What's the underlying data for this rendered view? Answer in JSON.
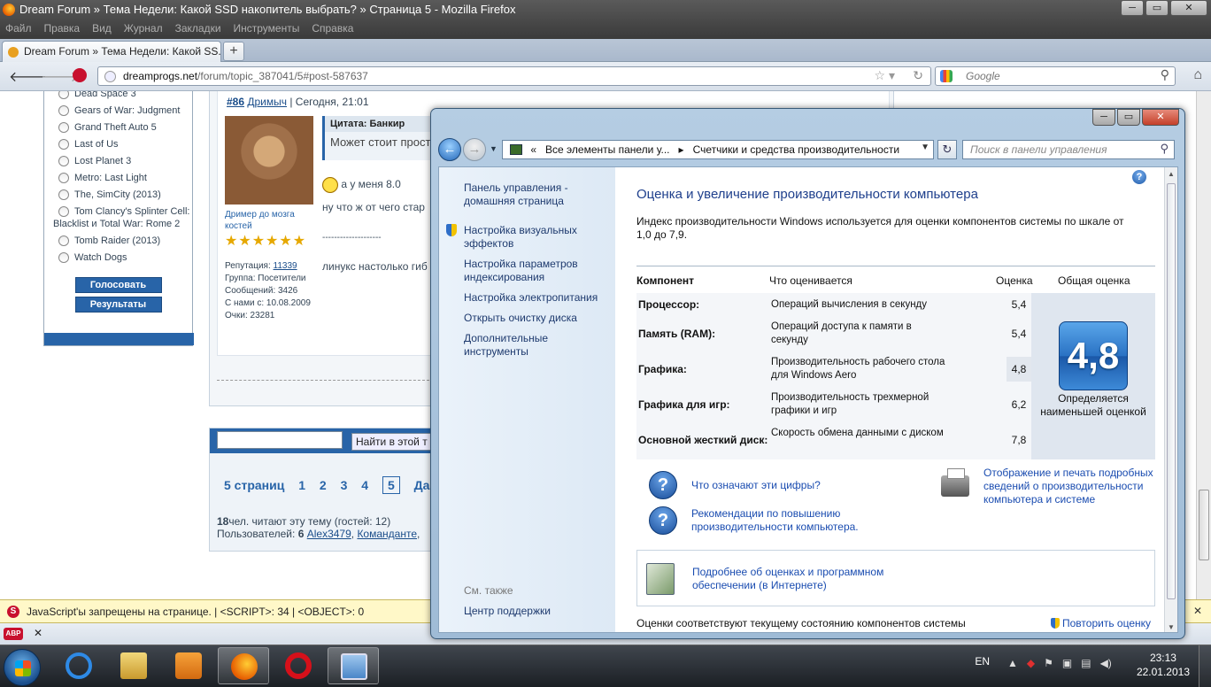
{
  "firefox": {
    "title": "Dream Forum » Тема Недели: Какой SSD накопитель выбрать? » Страница 5 - Mozilla Firefox",
    "menu": [
      "Файл",
      "Правка",
      "Вид",
      "Журнал",
      "Закладки",
      "Инструменты",
      "Справка"
    ],
    "tab_title": "Dream Forum » Тема Недели: Какой SS...",
    "url_host": "dreamprogs.net",
    "url_path": "/forum/topic_387041/5#post-587637",
    "search_engine": "Google",
    "window_buttons": {
      "min": "─",
      "max": "▭",
      "close": "✕"
    }
  },
  "poll": {
    "options": [
      "Dead Space 3",
      "Gears of War: Judgment",
      "Grand Theft Auto 5",
      "Last of Us",
      "Lost Planet 3",
      "Metro: Last Light",
      "The, SimCity (2013)",
      "Tom Clancy's Splinter Cell: Blacklist и Total War: Rome 2",
      "Tomb Raider (2013)",
      "Watch Dogs"
    ],
    "vote_button": "Голосовать",
    "results_button": "Результаты"
  },
  "post": {
    "number": "#86",
    "author": "Дримыч",
    "date": "| Сегодня, 21:01",
    "user_title": "Дример до мозга костей",
    "stars": "★★★★★★",
    "reputation_label": "Репутация:",
    "reputation": "11339",
    "group": "Группа: Посетители",
    "messages": "Сообщений: 3426",
    "since": "С нами с: 10.08.2009",
    "points": "Очки: 23281",
    "quote_header": "Цитата: Банкир",
    "quote_text": "Может стоит прост",
    "line1": "а у меня 8.0",
    "line2": "ну что ж от чего стар",
    "sig_sep": "--------------------",
    "line3": "линукс настолько гиб"
  },
  "search": {
    "button": "Найти в этой т",
    "pages_label": "5 страниц",
    "pages": [
      "1",
      "2",
      "3",
      "4"
    ],
    "current_page": "5",
    "next": "Да",
    "readers_count": "18",
    "readers_text": "чел. читают эту тему (гостей: 12)",
    "users_label": "Пользователей:",
    "users_count": "6",
    "user1": "Alex3479",
    "user2": "Команданте"
  },
  "noscript": {
    "text": "JavaScript'ы запрещены на странице. | <SCRIPT>: 34 | <OBJECT>: 0",
    "close": "✕"
  },
  "addon_bar": {
    "abp": "ABP",
    "close": "✕"
  },
  "control_panel": {
    "breadcrumb_root": "«",
    "breadcrumb_1": "Все элементы панели у...",
    "breadcrumb_sep": "▸",
    "breadcrumb_2": "Счетчики и средства производительности",
    "search_placeholder": "Поиск в панели управления",
    "left_nav": {
      "home": "Панель управления - домашняя страница",
      "visual_effects": "Настройка визуальных эффектов",
      "indexing": "Настройка параметров индексирования",
      "power": "Настройка электропитания",
      "disk_cleanup": "Открыть очистку диска",
      "advanced_tools": "Дополнительные инструменты",
      "see_also": "См. также",
      "action_center": "Центр поддержки"
    },
    "heading": "Оценка и увеличение производительности компьютера",
    "description": "Индекс производительности Windows используется для оценки компонентов системы по шкале от 1,0 до 7,9.",
    "table": {
      "col_component": "Компонент",
      "col_what": "Что оценивается",
      "col_score": "Оценка",
      "col_total": "Общая оценка",
      "rows": [
        {
          "component": "Процессор:",
          "what": "Операций вычисления в секунду",
          "score": "5,4"
        },
        {
          "component": "Память (RAM):",
          "what": "Операций доступа к памяти в секунду",
          "score": "5,4"
        },
        {
          "component": "Графика:",
          "what": "Производительность рабочего стола для Windows Aero",
          "score": "4,8"
        },
        {
          "component": "Графика для игр:",
          "what": "Производительность трехмерной графики и игр",
          "score": "6,2"
        },
        {
          "component": "Основной жесткий диск:",
          "what": "Скорость обмена данными с диском",
          "score": "7,8"
        }
      ],
      "base_score": "4,8",
      "base_caption": "Определяется наименьшей оценкой"
    },
    "links": {
      "what_numbers": "Что означают эти цифры?",
      "tips": "Рекомендации по повышению производительности компьютера.",
      "print": "Отображение и печать подробных сведений о производительности компьютера и системе",
      "online": "Подробнее об оценках и программном обеспечении (в Интернете)"
    },
    "footer_note": "Оценки соответствуют текущему состоянию компонентов системы",
    "retry": "Повторить оценку"
  },
  "taskbar": {
    "lang": "EN",
    "time": "23:13",
    "date": "22.01.2013"
  }
}
